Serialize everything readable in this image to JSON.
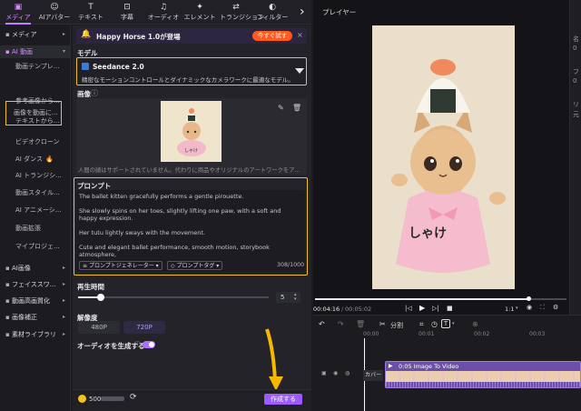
{
  "top_tabs": [
    {
      "icon": "media-icon",
      "glyph": "▣",
      "label": "メディア"
    },
    {
      "icon": "ai-avatar-icon",
      "glyph": "☺",
      "label": "AIアバター"
    },
    {
      "icon": "text-icon",
      "glyph": "T",
      "label": "テキスト"
    },
    {
      "icon": "subtitle-icon",
      "glyph": "⊡",
      "label": "字幕"
    },
    {
      "icon": "audio-icon",
      "glyph": "♫",
      "label": "オーディオ"
    },
    {
      "icon": "element-icon",
      "glyph": "✦",
      "label": "エレメント"
    },
    {
      "icon": "transition-icon",
      "glyph": "⇄",
      "label": "トランジション"
    },
    {
      "icon": "filter-icon",
      "glyph": "◐",
      "label": "フィルター"
    }
  ],
  "more_glyph": "›",
  "sidebar": {
    "items": [
      {
        "label": "メディア",
        "kind": "group",
        "chevron": "▸"
      },
      {
        "label": "AI 動画",
        "kind": "group",
        "chevron": "▾",
        "active": true
      },
      {
        "label": "動画テンプレ...",
        "kind": "sub"
      },
      {
        "label": "画像を動画に...",
        "kind": "sub",
        "selected": true
      },
      {
        "label": "参考画像から...",
        "kind": "sub"
      },
      {
        "label": "テキストから...",
        "kind": "sub"
      },
      {
        "label": "ビデオクローン",
        "kind": "sub"
      },
      {
        "label": "AI ダンス",
        "kind": "sub",
        "badge": "🔥"
      },
      {
        "label": "AI トランジシ...",
        "kind": "sub"
      },
      {
        "label": "動画スタイル...",
        "kind": "sub"
      },
      {
        "label": "AI アニメーシ...",
        "kind": "sub"
      },
      {
        "label": "動画拡張",
        "kind": "sub"
      },
      {
        "label": "マイプロジェ...",
        "kind": "sub"
      },
      {
        "label": "AI画像",
        "kind": "group",
        "chevron": "▸"
      },
      {
        "label": "フェイススワ...",
        "kind": "group",
        "chevron": "▸"
      },
      {
        "label": "動画高画質化",
        "kind": "group",
        "chevron": "▸"
      },
      {
        "label": "画像補正",
        "kind": "group",
        "chevron": "▸"
      },
      {
        "label": "素材ライブラリ",
        "kind": "group",
        "chevron": "▸"
      }
    ]
  },
  "banner": {
    "icon": "🔔",
    "text": "Happy Horse 1.0が登場",
    "cta": "今すぐ試す",
    "close": "×"
  },
  "model": {
    "label": "モデル",
    "name": "Seedance 2.0",
    "desc": "精密なモーションコントロールとダイナミックなカメラワークに最適なモデル。"
  },
  "image": {
    "label": "画像",
    "info": "ⓘ",
    "warning": "人間の顔はサポートされていません。代わりに商品やオリジナルのアートワークをア...",
    "shirt_text": "しゃけ"
  },
  "prompt": {
    "label": "プロンプト",
    "lines": [
      "The ballet kitten gracefully performs a gentle pirouette.",
      "",
      "She slowly spins on her toes, slightly lifting one paw, with a soft and happy expression.",
      "",
      "Her tutu lightly sways with the movement.",
      "",
      "Cute and elegant ballet performance, smooth motion, storybook atmosphere,"
    ],
    "generator_btn": "プロンプトジェネレーター",
    "tag_btn": "プロンプトタグ",
    "counter": "308/1000"
  },
  "duration": {
    "label": "再生時間",
    "value": "5",
    "fraction": 0.12
  },
  "resolution": {
    "label": "解像度",
    "options": [
      "480P",
      "720P"
    ],
    "selected": "720P"
  },
  "audio_toggle": {
    "label": "オーディオを生成する",
    "info": "ⓘ",
    "on": true
  },
  "footer": {
    "credits": "500",
    "create_btn": "作成する"
  },
  "player": {
    "title": "プレイヤー",
    "time_current": "00:04:16",
    "time_total": "00:05:02",
    "progress": 0.85,
    "speed": "1:1",
    "shirt_text": "しゃけ"
  },
  "timeline": {
    "split_label": "分割",
    "ruler": [
      "00:00",
      "00:01",
      "00:02",
      "00:03"
    ],
    "cover_label": "カバー",
    "clip_title": "0:05 Image To Video"
  },
  "props": {
    "lines": [
      "名",
      "0",
      "フ",
      "0",
      "リ",
      "元"
    ]
  },
  "colors": {
    "accent": "#c77dff",
    "highlight": "#f2c31c",
    "cta": "#ff5a1f",
    "arrow": "#f5b800"
  }
}
